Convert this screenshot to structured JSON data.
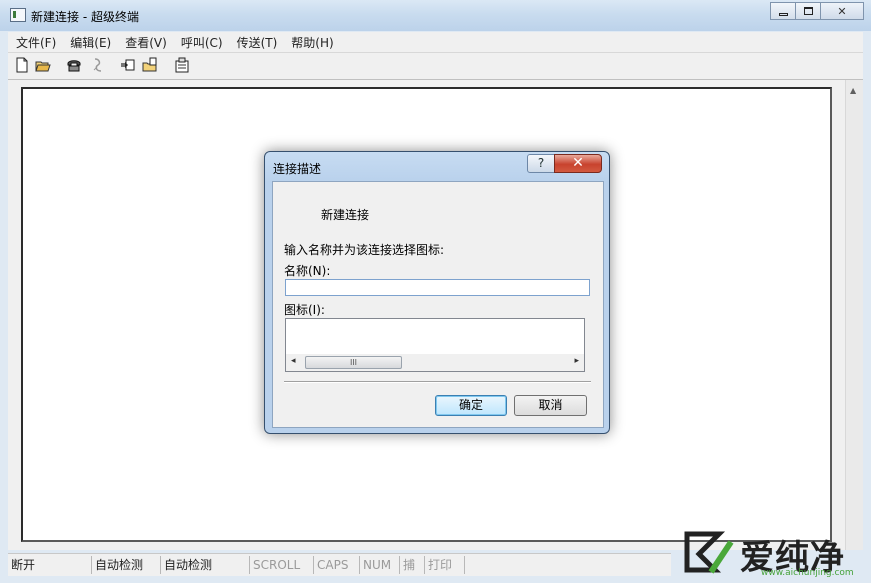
{
  "window": {
    "title": "新建连接 - 超级终端",
    "controls": {
      "minimize": "minimize",
      "maximize": "maximize",
      "close": "✕"
    }
  },
  "menu": [
    "文件(F)",
    "编辑(E)",
    "查看(V)",
    "呼叫(C)",
    "传送(T)",
    "帮助(H)"
  ],
  "toolbar": [
    "new-icon",
    "open-icon",
    "phone-icon",
    "disconnect-icon",
    "send-icon",
    "receive-icon",
    "properties-icon"
  ],
  "dialog": {
    "title": "连接描述",
    "help": "?",
    "close": "✕",
    "connection_name": "新建连接",
    "prompt": "输入名称并为该连接选择图标:",
    "name_label": "名称(N):",
    "name_value": "",
    "icon_label": "图标(I):",
    "scroll_left": "◂",
    "scroll_right": "▸",
    "scroll_thumb": "III",
    "ok": "确定",
    "cancel": "取消"
  },
  "status": [
    "断开",
    "自动检测",
    "自动检测",
    "SCROLL",
    "CAPS",
    "NUM",
    "捕",
    "打印"
  ],
  "watermark": {
    "name": "爱纯净",
    "url": "www.aichunjing.com"
  }
}
